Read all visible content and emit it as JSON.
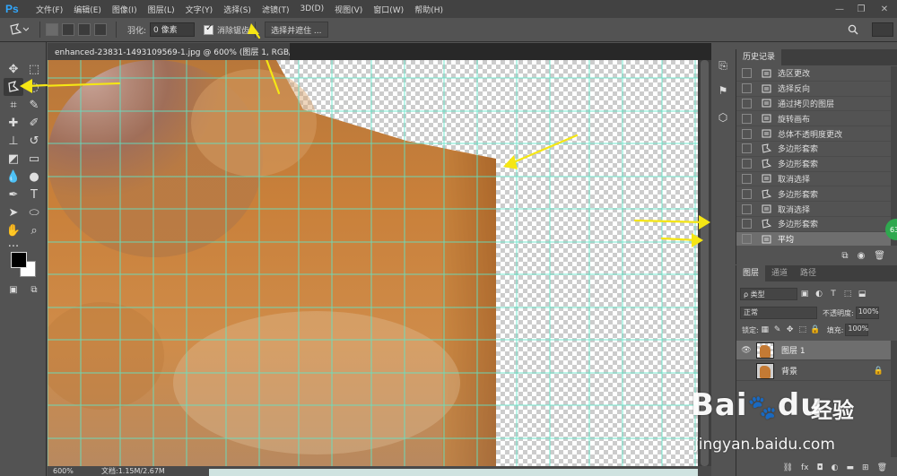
{
  "app": {
    "logo": "Ps"
  },
  "menu": [
    "文件(F)",
    "编辑(E)",
    "图像(I)",
    "图层(L)",
    "文字(Y)",
    "选择(S)",
    "滤镜(T)",
    "3D(D)",
    "视图(V)",
    "窗口(W)",
    "帮助(H)"
  ],
  "options": {
    "feather_label": "羽化:",
    "feather_value": "0 像素",
    "antialias_label": "消除锯齿",
    "select_mask_label": "选择并遮住 ..."
  },
  "document": {
    "tab_title": "enhanced-23831-1493109569-1.jpg @ 600% (图层 1, RGB/8#) *",
    "zoom": "600%",
    "doc_size": "文档:1.15M/2.67M"
  },
  "history": {
    "tab": "历史记录",
    "items": [
      {
        "label": "选区更改",
        "icon": "selection-icon"
      },
      {
        "label": "选择反向",
        "icon": "doc-icon"
      },
      {
        "label": "通过拷贝的图层",
        "icon": "doc-icon"
      },
      {
        "label": "旋转画布",
        "icon": "doc-icon"
      },
      {
        "label": "总体不透明度更改",
        "icon": "doc-icon"
      },
      {
        "label": "多边形套索",
        "icon": "polygon-lasso-icon"
      },
      {
        "label": "多边形套索",
        "icon": "polygon-lasso-icon"
      },
      {
        "label": "取消选择",
        "icon": "doc-icon"
      },
      {
        "label": "多边形套索",
        "icon": "polygon-lasso-icon"
      },
      {
        "label": "取消选择",
        "icon": "doc-icon"
      },
      {
        "label": "多边形套索",
        "icon": "polygon-lasso-icon"
      },
      {
        "label": "平均",
        "icon": "doc-icon",
        "selected": true
      }
    ],
    "badge": "63"
  },
  "layers": {
    "tabs": [
      "图层",
      "通道",
      "路径"
    ],
    "filter_label": "ρ 类型",
    "blend_mode": "正常",
    "opacity_label": "不透明度:",
    "opacity_value": "100%",
    "lock_label": "锁定:",
    "fill_label": "填充:",
    "fill_value": "100%",
    "items": [
      {
        "name": "图层 1",
        "active": true
      },
      {
        "name": "背景",
        "active": false
      }
    ]
  },
  "watermark": {
    "brand": "Bai",
    "brand2": "du",
    "cn": "经验",
    "url": "jingyan.baidu.com"
  },
  "colors": {
    "accent_arrow": "#f5e614",
    "guide": "#5fe6c8",
    "canvas_fur": "#c97a35"
  }
}
